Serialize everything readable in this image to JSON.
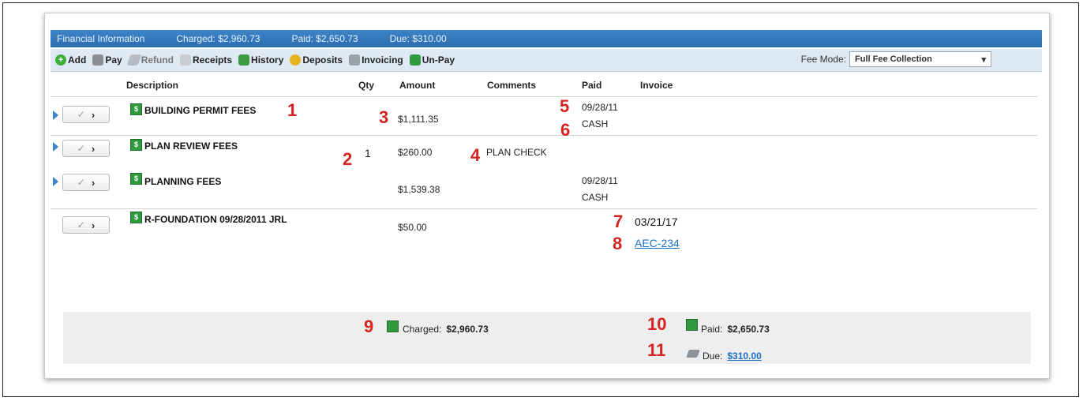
{
  "titlebar": {
    "title": "Financial Information",
    "charged": "Charged: $2,960.73",
    "paid": "Paid: $2,650.73",
    "due": "Due: $310.00"
  },
  "toolbar": {
    "add": "Add",
    "pay": "Pay",
    "refund": "Refund",
    "receipts": "Receipts",
    "history": "History",
    "deposits": "Deposits",
    "invoicing": "Invoicing",
    "unpay": "Un-Pay",
    "fee_mode_label": "Fee Mode:",
    "fee_mode_value": "Full Fee Collection"
  },
  "columns": {
    "description": "Description",
    "qty": "Qty",
    "amount": "Amount",
    "comments": "Comments",
    "paid": "Paid",
    "invoice": "Invoice"
  },
  "rows": [
    {
      "description": "BUILDING PERMIT FEES",
      "qty": "",
      "amount": "$1,111.35",
      "comments": "",
      "paid_date": "09/28/11",
      "paid_method": "CASH",
      "invoice_date": "",
      "invoice_link": ""
    },
    {
      "description": "PLAN REVIEW FEES",
      "qty": "1",
      "amount": "$260.00",
      "comments": "PLAN CHECK",
      "paid_date": "",
      "paid_method": "",
      "invoice_date": "",
      "invoice_link": ""
    },
    {
      "description": "PLANNING FEES",
      "qty": "",
      "amount": "$1,539.38",
      "comments": "",
      "paid_date": "09/28/11",
      "paid_method": "CASH",
      "invoice_date": "",
      "invoice_link": ""
    },
    {
      "description": "R-FOUNDATION 09/28/2011 JRL",
      "qty": "",
      "amount": "$50.00",
      "comments": "",
      "paid_date": "",
      "paid_method": "",
      "invoice_date": "03/21/17",
      "invoice_link": "AEC-234"
    }
  ],
  "footer": {
    "charged_label": "Charged:",
    "charged_value": "$2,960.73",
    "paid_label": "Paid:",
    "paid_value": "$2,650.73",
    "due_label": "Due:",
    "due_value": "$310.00"
  },
  "callouts": [
    "1",
    "2",
    "3",
    "4",
    "5",
    "6",
    "7",
    "8",
    "9",
    "10",
    "11"
  ],
  "colors": {
    "accent": "#2b6db0",
    "callout": "#d4241f",
    "link": "#1a6fc4"
  }
}
